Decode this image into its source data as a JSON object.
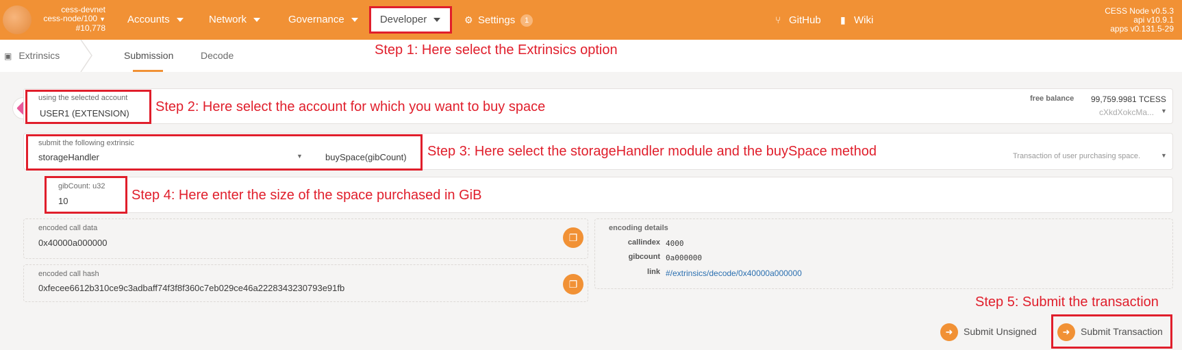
{
  "header": {
    "chain": {
      "name": "cess-devnet",
      "node": "cess-node/100",
      "block": "#10,778"
    },
    "nav": {
      "accounts": "Accounts",
      "network": "Network",
      "governance": "Governance",
      "developer": "Developer",
      "settings": "Settings",
      "settings_badge": "1"
    },
    "links": {
      "github": "GitHub",
      "wiki": "Wiki"
    },
    "version": {
      "node": "CESS Node v0.5.3",
      "api": "api v10.9.1",
      "apps": "apps v0.131.5-29"
    },
    "accent_color": "#f19135"
  },
  "subnav": {
    "section": "Extrinsics",
    "tabs": [
      "Submission",
      "Decode"
    ],
    "active_tab": "Submission"
  },
  "annotations": {
    "step1": "Step 1: Here select the Extrinsics option",
    "step2": "Step 2: Here select the account for which you want to buy space",
    "step3": "Step 3: Here select the storageHandler module and the buySpace method",
    "step4": "Step 4: Here enter the size of the space purchased in GiB",
    "step5": "Step 5: Submit the transaction",
    "highlight_color": "#e01e2b"
  },
  "account": {
    "label": "using the selected account",
    "value": "USER1 (EXTENSION)",
    "balance_label": "free balance",
    "balance_value": "99,759.9981 TCESS",
    "address": "cXkdXokcMa..."
  },
  "extrinsic": {
    "label": "submit the following extrinsic",
    "module": "storageHandler",
    "method": "buySpace(gibCount)",
    "description": "Transaction of user purchasing space."
  },
  "param": {
    "label": "gibCount: u32",
    "value": "10"
  },
  "encoded": {
    "call_data_label": "encoded call data",
    "call_data": "0x40000a000000",
    "call_hash_label": "encoded call hash",
    "call_hash": "0xfecee6612b310ce9c3adbaff74f3f8f360c7eb029ce46a2228343230793e91fb",
    "details_label": "encoding details",
    "callindex_label": "callindex",
    "callindex": "4000",
    "gibcount_label": "gibcount",
    "gibcount": "0a000000",
    "link_label": "link",
    "link": "#/extrinsics/decode/0x40000a000000"
  },
  "actions": {
    "unsigned": "Submit Unsigned",
    "submit": "Submit Transaction"
  }
}
